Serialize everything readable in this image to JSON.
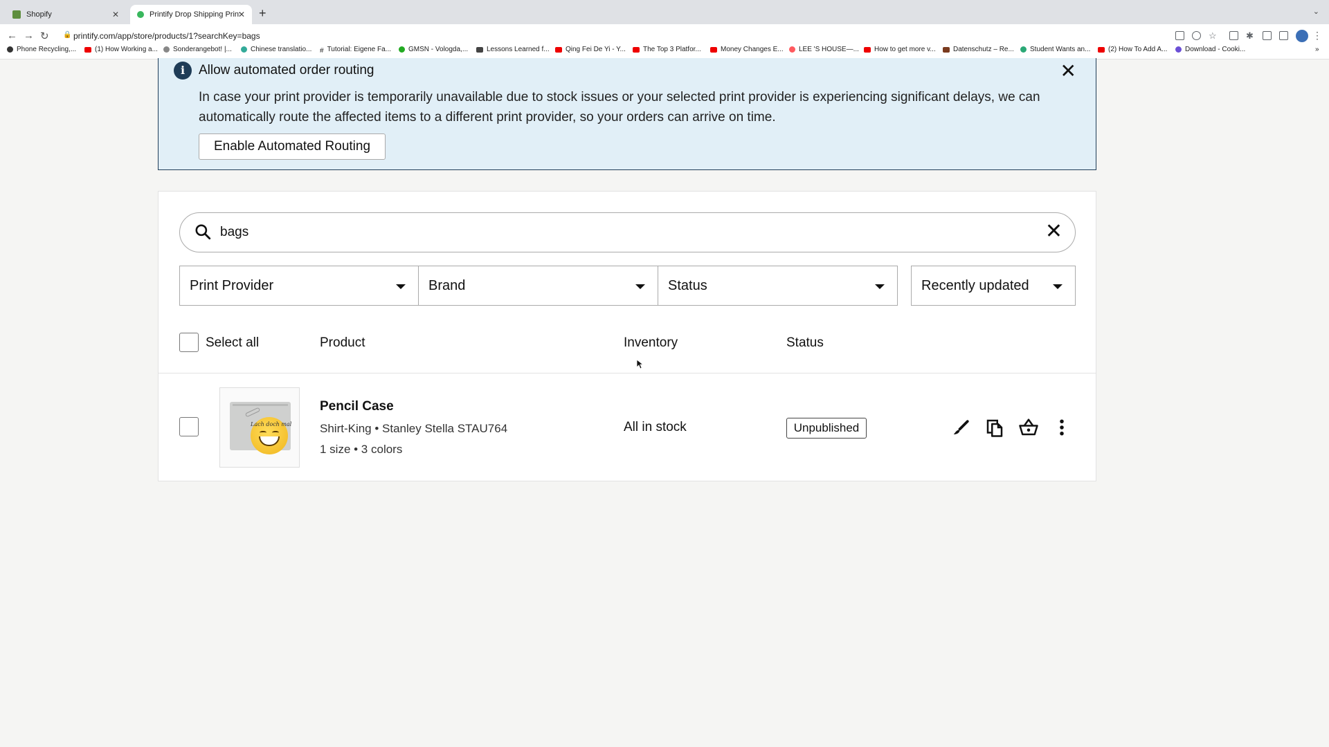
{
  "browser": {
    "tabs": [
      {
        "title": "Shopify",
        "active": false
      },
      {
        "title": "Printify Drop Shipping Print on",
        "active": true
      }
    ],
    "url": "printify.com/app/store/products/1?searchKey=bags",
    "bookmarks": [
      "Phone Recycling,...",
      "(1) How Working a...",
      "Sonderangebot! |...",
      "Chinese translatio...",
      "Tutorial: Eigene Fa...",
      "GMSN - Vologda,...",
      "Lessons Learned f...",
      "Qing Fei De Yi - Y...",
      "The Top 3 Platfor...",
      "Money Changes E...",
      "LEE 'S HOUSE—...",
      "How to get more v...",
      "Datenschutz – Re...",
      "Student Wants an...",
      "(2) How To Add A...",
      "Download - Cooki..."
    ]
  },
  "banner": {
    "title": "Allow automated order routing",
    "text": "In case your print provider is temporarily unavailable due to stock issues or your selected print provider is experiencing significant delays, we can automatically route the affected items to a different print provider, so your orders can arrive on time.",
    "button": "Enable Automated Routing"
  },
  "search": {
    "value": "bags"
  },
  "filters": {
    "print_provider": "Print Provider",
    "brand": "Brand",
    "status": "Status",
    "sort": "Recently updated"
  },
  "table": {
    "select_all": "Select all",
    "headers": {
      "product": "Product",
      "inventory": "Inventory",
      "status": "Status"
    },
    "rows": [
      {
        "name": "Pencil Case",
        "brand": "Shirt-King • Stanley Stella STAU764",
        "variants": "1 size • 3 colors",
        "inventory": "All in stock",
        "status": "Unpublished",
        "thumb_text": "Lach doch mal"
      }
    ]
  },
  "colors": {
    "banner_bg": "#e1eff7",
    "banner_border": "#1f3c57",
    "page_bg": "#f5f5f3"
  }
}
